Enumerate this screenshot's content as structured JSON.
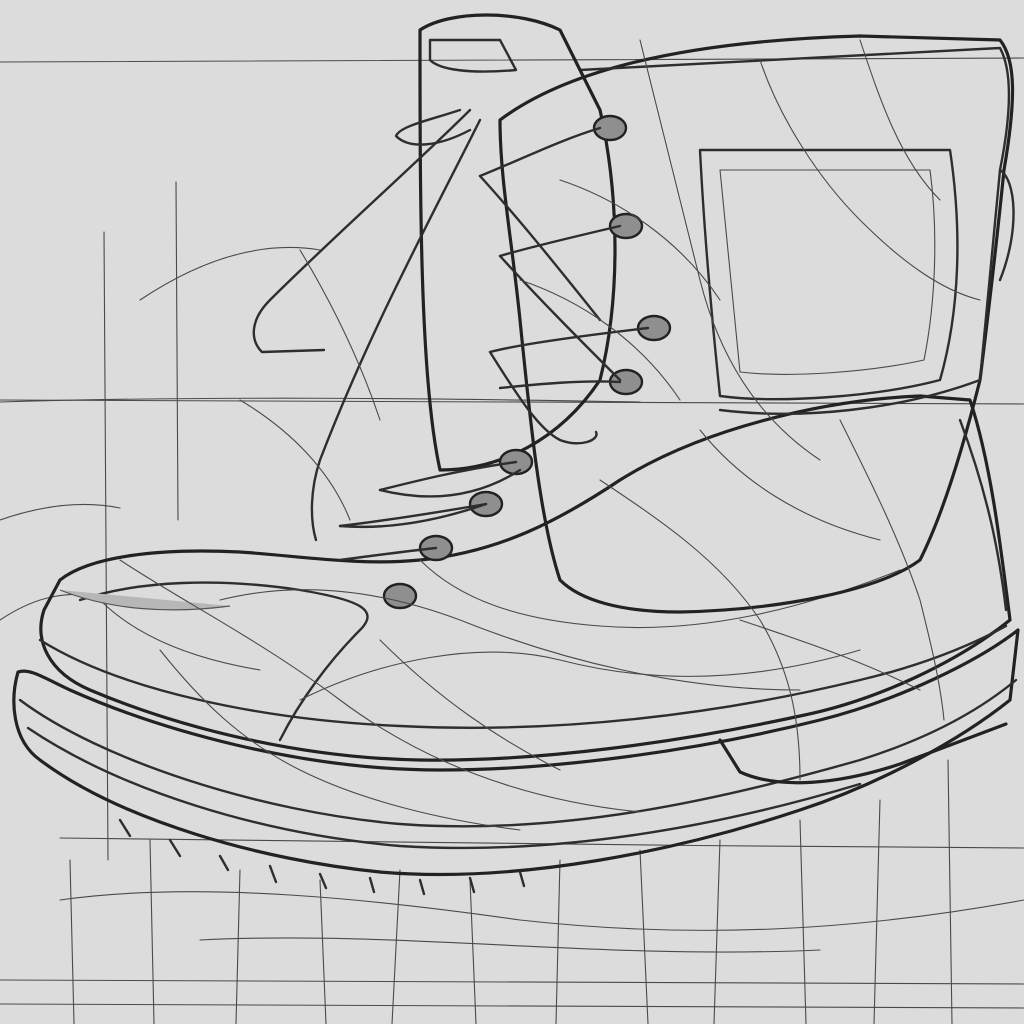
{
  "colors": {
    "background": "#dcdcdc",
    "ink": "#2e2e2e",
    "shade_light": "#cdcdcd",
    "shade_mid": "#bdbdbd",
    "shade_dark": "#a9a9a9"
  },
  "icons": [
    "boot-illustration"
  ]
}
